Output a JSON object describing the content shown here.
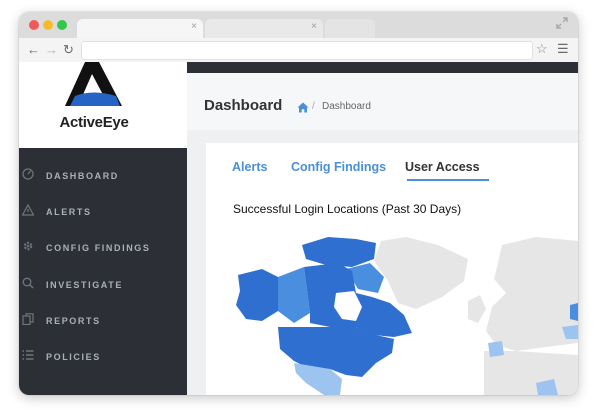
{
  "browser": {
    "tab_close_glyph": "×",
    "nav": {
      "back": "←",
      "forward": "→",
      "reload": "↻"
    }
  },
  "brand": {
    "name": "ActiveEye"
  },
  "sidebar": {
    "items": [
      {
        "label": "DASHBOARD",
        "icon": "dashboard-icon"
      },
      {
        "label": "ALERTS",
        "icon": "warning-icon"
      },
      {
        "label": "CONFIG FINDINGS",
        "icon": "gear-icon"
      },
      {
        "label": "INVESTIGATE",
        "icon": "search-icon"
      },
      {
        "label": "REPORTS",
        "icon": "documents-icon"
      },
      {
        "label": "POLICIES",
        "icon": "list-icon"
      }
    ]
  },
  "header": {
    "title": "Dashboard",
    "breadcrumb": {
      "separator": "/",
      "current": "Dashboard"
    }
  },
  "tabs": [
    {
      "label": "Alerts",
      "active": false
    },
    {
      "label": "Config Findings",
      "active": false
    },
    {
      "label": "User Access",
      "active": true
    }
  ],
  "map": {
    "title": "Successful Login Locations (Past 30 Days)",
    "colors": {
      "high": "#2f6fd0",
      "mid": "#4a8ee0",
      "low": "#9dc3ef",
      "none": "#e6e6e6"
    }
  },
  "colors": {
    "accent": "#4a8fd8",
    "sidebar": "#2c3036",
    "logo_blue": "#2563c4"
  }
}
